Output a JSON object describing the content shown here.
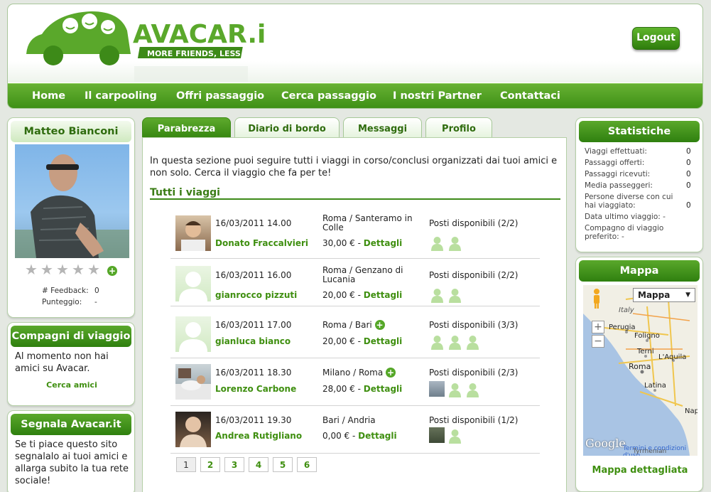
{
  "header": {
    "logo_brand": "AVACAR.it",
    "logo_tagline": "MORE FRIENDS, LESS CARS.",
    "logout_label": "Logout",
    "nav": [
      "Home",
      "Il carpooling",
      "Offri passaggio",
      "Cerca passaggio",
      "I nostri Partner",
      "Contattaci"
    ]
  },
  "profile": {
    "name": "Matteo Bianconi",
    "rating_stars": 0,
    "feedback_label": "# Feedback:",
    "feedback_value": "0",
    "score_label": "Punteggio:",
    "score_value": "-"
  },
  "companions": {
    "title": "Compagni di viaggio",
    "text": "Al momento non hai amici su Avacar.",
    "link": "Cerca amici"
  },
  "share": {
    "title": "Segnala Avacar.it",
    "text": "Se ti piace questo sito segnalalo ai tuoi amici e allarga subito la tua rete sociale!"
  },
  "tabs": [
    "Parabrezza",
    "Diario di bordo",
    "Messaggi",
    "Profilo"
  ],
  "main": {
    "intro": "In questa sezione puoi seguire tutti i viaggi in corso/conclusi organizzati dai tuoi amici e non solo. Cerca il viaggio che fa per te!",
    "section_title": "Tutti i viaggi",
    "details_label": "Dettagli",
    "rides": [
      {
        "datetime": "16/03/2011 14.00",
        "driver": "Donato Fraccalvieri",
        "route": "Roma / Santeramo in Colle",
        "price": "30,00 € -",
        "seats": "Posti disponibili (2/2)",
        "avatar": "photo"
      },
      {
        "datetime": "16/03/2011 16.00",
        "driver": "gianrocco pizzuti",
        "route": "Roma / Genzano di Lucania",
        "price": "20,00 € -",
        "seats": "Posti disponibili (2/2)",
        "avatar": "generic"
      },
      {
        "datetime": "16/03/2011 17.00",
        "driver": "gianluca bianco",
        "route": "Roma / Bari",
        "price": "20,00 € -",
        "seats": "Posti disponibili (3/3)",
        "avatar": "generic"
      },
      {
        "datetime": "16/03/2011 18.30",
        "driver": "Lorenzo Carbone",
        "route": "Milano / Roma",
        "price": "28,00 € -",
        "seats": "Posti disponibili (2/3)",
        "avatar": "photo"
      },
      {
        "datetime": "16/03/2011 19.30",
        "driver": "Andrea Rutigliano",
        "route": "Bari / Andria",
        "price": "0,00 € -",
        "seats": "Posti disponibili (1/2)",
        "avatar": "photo"
      }
    ],
    "pages": [
      "1",
      "2",
      "3",
      "4",
      "5",
      "6"
    ]
  },
  "stats": {
    "title": "Statistiche",
    "rows": [
      {
        "label": "Viaggi effettuati:",
        "value": "0"
      },
      {
        "label": "Passaggi offerti:",
        "value": "0"
      },
      {
        "label": "Passaggi ricevuti:",
        "value": "0"
      },
      {
        "label": "Media passeggeri:",
        "value": "0"
      },
      {
        "label": "Persone diverse con cui hai viaggiato:",
        "value": "0"
      },
      {
        "label": "Data ultimo viaggio:",
        "value": "-"
      },
      {
        "label": "Compagno di viaggio preferito:",
        "value": "-"
      }
    ]
  },
  "map": {
    "title": "Mappa",
    "type_select": "Mappa",
    "cities": [
      "Italy",
      "Perugia",
      "Foligno",
      "Terni",
      "L'Aquila",
      "Roma",
      "Latina",
      "Nap",
      "Tyrrhenian"
    ],
    "google": "Google",
    "terms": "Termini e condizioni d'uso",
    "link": "Mappa dettagliata"
  },
  "colors": {
    "accent": "#3f8f10",
    "nav": "#4a9c1e"
  }
}
